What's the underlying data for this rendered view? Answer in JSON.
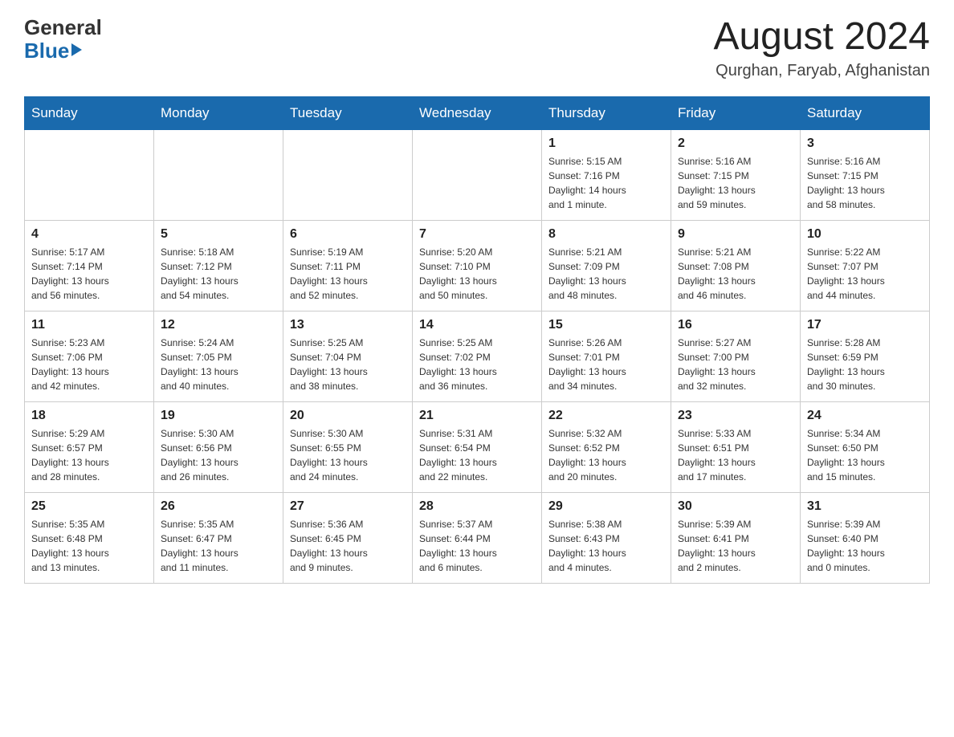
{
  "header": {
    "logo_general": "General",
    "logo_blue": "Blue",
    "month_title": "August 2024",
    "location": "Qurghan, Faryab, Afghanistan"
  },
  "days_of_week": [
    "Sunday",
    "Monday",
    "Tuesday",
    "Wednesday",
    "Thursday",
    "Friday",
    "Saturday"
  ],
  "weeks": [
    [
      {
        "day": "",
        "info": ""
      },
      {
        "day": "",
        "info": ""
      },
      {
        "day": "",
        "info": ""
      },
      {
        "day": "",
        "info": ""
      },
      {
        "day": "1",
        "info": "Sunrise: 5:15 AM\nSunset: 7:16 PM\nDaylight: 14 hours\nand 1 minute."
      },
      {
        "day": "2",
        "info": "Sunrise: 5:16 AM\nSunset: 7:15 PM\nDaylight: 13 hours\nand 59 minutes."
      },
      {
        "day": "3",
        "info": "Sunrise: 5:16 AM\nSunset: 7:15 PM\nDaylight: 13 hours\nand 58 minutes."
      }
    ],
    [
      {
        "day": "4",
        "info": "Sunrise: 5:17 AM\nSunset: 7:14 PM\nDaylight: 13 hours\nand 56 minutes."
      },
      {
        "day": "5",
        "info": "Sunrise: 5:18 AM\nSunset: 7:12 PM\nDaylight: 13 hours\nand 54 minutes."
      },
      {
        "day": "6",
        "info": "Sunrise: 5:19 AM\nSunset: 7:11 PM\nDaylight: 13 hours\nand 52 minutes."
      },
      {
        "day": "7",
        "info": "Sunrise: 5:20 AM\nSunset: 7:10 PM\nDaylight: 13 hours\nand 50 minutes."
      },
      {
        "day": "8",
        "info": "Sunrise: 5:21 AM\nSunset: 7:09 PM\nDaylight: 13 hours\nand 48 minutes."
      },
      {
        "day": "9",
        "info": "Sunrise: 5:21 AM\nSunset: 7:08 PM\nDaylight: 13 hours\nand 46 minutes."
      },
      {
        "day": "10",
        "info": "Sunrise: 5:22 AM\nSunset: 7:07 PM\nDaylight: 13 hours\nand 44 minutes."
      }
    ],
    [
      {
        "day": "11",
        "info": "Sunrise: 5:23 AM\nSunset: 7:06 PM\nDaylight: 13 hours\nand 42 minutes."
      },
      {
        "day": "12",
        "info": "Sunrise: 5:24 AM\nSunset: 7:05 PM\nDaylight: 13 hours\nand 40 minutes."
      },
      {
        "day": "13",
        "info": "Sunrise: 5:25 AM\nSunset: 7:04 PM\nDaylight: 13 hours\nand 38 minutes."
      },
      {
        "day": "14",
        "info": "Sunrise: 5:25 AM\nSunset: 7:02 PM\nDaylight: 13 hours\nand 36 minutes."
      },
      {
        "day": "15",
        "info": "Sunrise: 5:26 AM\nSunset: 7:01 PM\nDaylight: 13 hours\nand 34 minutes."
      },
      {
        "day": "16",
        "info": "Sunrise: 5:27 AM\nSunset: 7:00 PM\nDaylight: 13 hours\nand 32 minutes."
      },
      {
        "day": "17",
        "info": "Sunrise: 5:28 AM\nSunset: 6:59 PM\nDaylight: 13 hours\nand 30 minutes."
      }
    ],
    [
      {
        "day": "18",
        "info": "Sunrise: 5:29 AM\nSunset: 6:57 PM\nDaylight: 13 hours\nand 28 minutes."
      },
      {
        "day": "19",
        "info": "Sunrise: 5:30 AM\nSunset: 6:56 PM\nDaylight: 13 hours\nand 26 minutes."
      },
      {
        "day": "20",
        "info": "Sunrise: 5:30 AM\nSunset: 6:55 PM\nDaylight: 13 hours\nand 24 minutes."
      },
      {
        "day": "21",
        "info": "Sunrise: 5:31 AM\nSunset: 6:54 PM\nDaylight: 13 hours\nand 22 minutes."
      },
      {
        "day": "22",
        "info": "Sunrise: 5:32 AM\nSunset: 6:52 PM\nDaylight: 13 hours\nand 20 minutes."
      },
      {
        "day": "23",
        "info": "Sunrise: 5:33 AM\nSunset: 6:51 PM\nDaylight: 13 hours\nand 17 minutes."
      },
      {
        "day": "24",
        "info": "Sunrise: 5:34 AM\nSunset: 6:50 PM\nDaylight: 13 hours\nand 15 minutes."
      }
    ],
    [
      {
        "day": "25",
        "info": "Sunrise: 5:35 AM\nSunset: 6:48 PM\nDaylight: 13 hours\nand 13 minutes."
      },
      {
        "day": "26",
        "info": "Sunrise: 5:35 AM\nSunset: 6:47 PM\nDaylight: 13 hours\nand 11 minutes."
      },
      {
        "day": "27",
        "info": "Sunrise: 5:36 AM\nSunset: 6:45 PM\nDaylight: 13 hours\nand 9 minutes."
      },
      {
        "day": "28",
        "info": "Sunrise: 5:37 AM\nSunset: 6:44 PM\nDaylight: 13 hours\nand 6 minutes."
      },
      {
        "day": "29",
        "info": "Sunrise: 5:38 AM\nSunset: 6:43 PM\nDaylight: 13 hours\nand 4 minutes."
      },
      {
        "day": "30",
        "info": "Sunrise: 5:39 AM\nSunset: 6:41 PM\nDaylight: 13 hours\nand 2 minutes."
      },
      {
        "day": "31",
        "info": "Sunrise: 5:39 AM\nSunset: 6:40 PM\nDaylight: 13 hours\nand 0 minutes."
      }
    ]
  ]
}
